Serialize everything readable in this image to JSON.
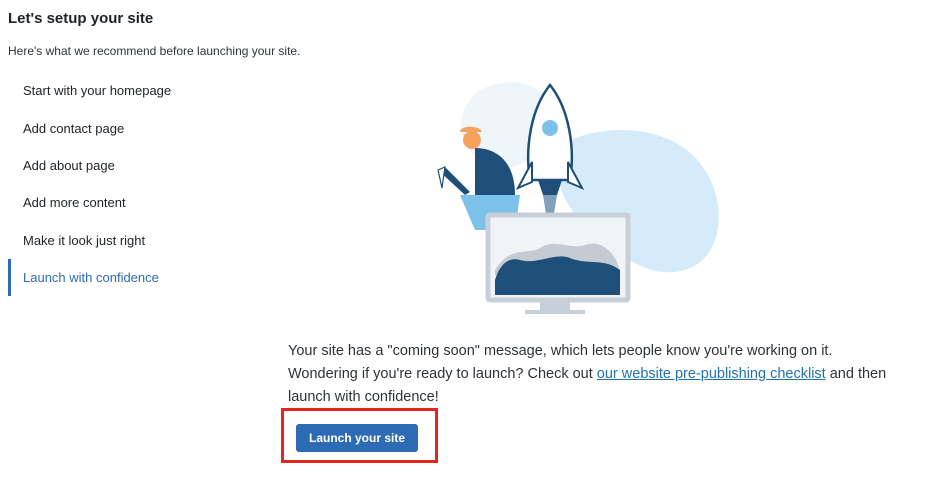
{
  "header": {
    "title": "Let's setup your site",
    "subtitle": "Here's what we recommend before launching your site."
  },
  "steps": [
    {
      "label": "Start with your homepage"
    },
    {
      "label": "Add contact page"
    },
    {
      "label": "Add about page"
    },
    {
      "label": "Add more content"
    },
    {
      "label": "Make it look just right"
    },
    {
      "label": "Launch with confidence",
      "active": true
    }
  ],
  "content": {
    "illustration": "rocket-launch-illustration",
    "message_before": "Your site has a \"coming soon\" message, which lets people know you're working on it. Wondering if you're ready to launch? Check out ",
    "link_text": "our website pre-publishing checklist",
    "message_after": " and then launch with confidence!",
    "button_label": "Launch your site"
  },
  "colors": {
    "accent": "#2d6bb4",
    "highlight": "#e6261c"
  }
}
